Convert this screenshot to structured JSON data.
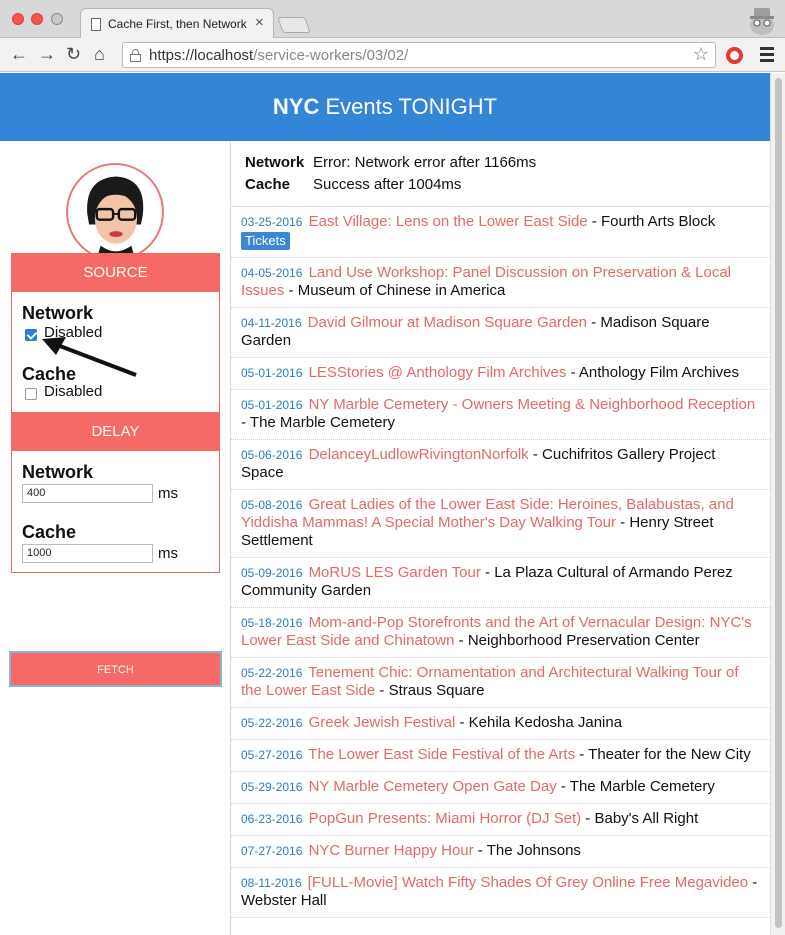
{
  "browser": {
    "tab_title": "Cache First, then Network",
    "tab_close": "×",
    "url_scheme": "https://localhost",
    "url_path": "/service-workers/03/02/"
  },
  "header": {
    "brand": "NYC",
    "title_rest": " Events TONIGHT"
  },
  "sidebar": {
    "source_title": "SOURCE",
    "network_label": "Network",
    "network_disabled_label": "Disabled",
    "network_disabled_checked": true,
    "cache_label": "Cache",
    "cache_disabled_label": "Disabled",
    "cache_disabled_checked": false,
    "delay_title": "DELAY",
    "delay_network_label": "Network",
    "delay_network_value": "400",
    "delay_cache_label": "Cache",
    "delay_cache_value": "1000",
    "unit": "ms",
    "fetch_label": "FETCH"
  },
  "status": {
    "network_label": "Network",
    "network_text": "Error: Network error after 1166ms",
    "cache_label": "Cache",
    "cache_text": "Success after 1004ms"
  },
  "events": [
    {
      "date": "03-25-2016",
      "title": "East Village: Lens on the Lower East Side",
      "venue": "Fourth Arts Block",
      "tickets": "Tickets"
    },
    {
      "date": "04-05-2016",
      "title": "Land Use Workshop: Panel Discussion on Preservation & Local Issues",
      "venue": "Museum of Chinese in America"
    },
    {
      "date": "04-11-2016",
      "title": "David Gilmour at Madison Square Garden",
      "venue": "Madison Square Garden"
    },
    {
      "date": "05-01-2016",
      "title": "LESStories @ Anthology Film Archives",
      "venue": "Anthology Film Archives"
    },
    {
      "date": "05-01-2016",
      "title": "NY Marble Cemetery - Owners Meeting & Neighborhood Reception",
      "venue": "The Marble Cemetery"
    },
    {
      "date": "05-06-2016",
      "title": "DelanceyLudlowRivingtonNorfolk",
      "venue": "Cuchifritos Gallery Project Space"
    },
    {
      "date": "05-08-2016",
      "title": "Great Ladies of the Lower East Side: Heroines, Balabustas, and Yiddisha Mammas! A Special Mother's Day Walking Tour",
      "venue": "Henry Street Settlement"
    },
    {
      "date": "05-09-2016",
      "title": "MoRUS LES Garden Tour",
      "venue": "La Plaza Cultural of Armando Perez Community Garden"
    },
    {
      "date": "05-18-2016",
      "title": "Mom-and-Pop Storefronts and the Art of Vernacular Design: NYC's Lower East Side and Chinatown",
      "venue": "Neighborhood Preservation Center"
    },
    {
      "date": "05-22-2016",
      "title": "Tenement Chic: Ornamentation and Architectural Walking Tour of the Lower East Side",
      "venue": "Straus Square"
    },
    {
      "date": "05-22-2016",
      "title": "Greek Jewish Festival",
      "venue": "Kehila Kedosha Janina"
    },
    {
      "date": "05-27-2016",
      "title": "The Lower East Side Festival of the Arts",
      "venue": "Theater for the New City"
    },
    {
      "date": "05-29-2016",
      "title": "NY Marble Cemetery Open Gate Day",
      "venue": "The Marble Cemetery"
    },
    {
      "date": "06-23-2016",
      "title": "PopGun Presents: Miami Horror (DJ Set)",
      "venue": "Baby's All Right"
    },
    {
      "date": "07-27-2016",
      "title": "NYC Burner Happy Hour",
      "venue": "The Johnsons"
    },
    {
      "date": "08-11-2016",
      "title": "[FULL-Movie] Watch Fifty Shades Of Grey Online Free Megavideo",
      "venue": "Webster Hall"
    }
  ],
  "colors": {
    "header_blue": "#3385d6",
    "accent_red": "#f56a66",
    "link_red": "#e36a66",
    "date_blue": "#2f7bc4"
  }
}
